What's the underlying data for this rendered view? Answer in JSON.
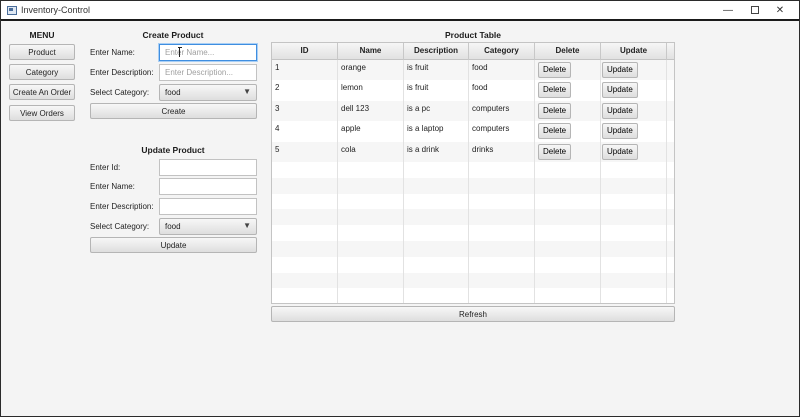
{
  "window": {
    "title": "Inventory-Control"
  },
  "menu": {
    "title": "MENU",
    "items": [
      "Product",
      "Category",
      "Create An Order",
      "View Orders"
    ]
  },
  "create_product": {
    "title": "Create Product",
    "name_label": "Enter Name:",
    "name_placeholder": "Enter Name...",
    "desc_label": "Enter Description:",
    "desc_placeholder": "Enter Description...",
    "category_label": "Select Category:",
    "category_value": "food",
    "button": "Create"
  },
  "update_product": {
    "title": "Update Product",
    "id_label": "Enter Id:",
    "name_label": "Enter Name:",
    "desc_label": "Enter Description:",
    "category_label": "Select Category:",
    "category_value": "food",
    "button": "Update"
  },
  "product_table": {
    "title": "Product Table",
    "columns": [
      "ID",
      "Name",
      "Description",
      "Category",
      "Delete",
      "Update"
    ],
    "rows": [
      {
        "id": "1",
        "name": "orange",
        "description": "is fruit",
        "category": "food",
        "delete": "Delete",
        "update": "Update"
      },
      {
        "id": "2",
        "name": "lemon",
        "description": "is fruit",
        "category": "food",
        "delete": "Delete",
        "update": "Update"
      },
      {
        "id": "3",
        "name": "dell 123",
        "description": "is a pc",
        "category": "computers",
        "delete": "Delete",
        "update": "Update"
      },
      {
        "id": "4",
        "name": "apple",
        "description": "is a laptop",
        "category": "computers",
        "delete": "Delete",
        "update": "Update"
      },
      {
        "id": "5",
        "name": "cola",
        "description": "is a drink",
        "category": "drinks",
        "delete": "Delete",
        "update": "Update"
      }
    ],
    "refresh_button": "Refresh"
  },
  "colors": {
    "focus": "#3f8ee0",
    "window_border": "#1a1a1a"
  },
  "icons": [
    "app-icon",
    "minimize-icon",
    "maximize-icon",
    "close-icon",
    "chevron-down-icon"
  ]
}
